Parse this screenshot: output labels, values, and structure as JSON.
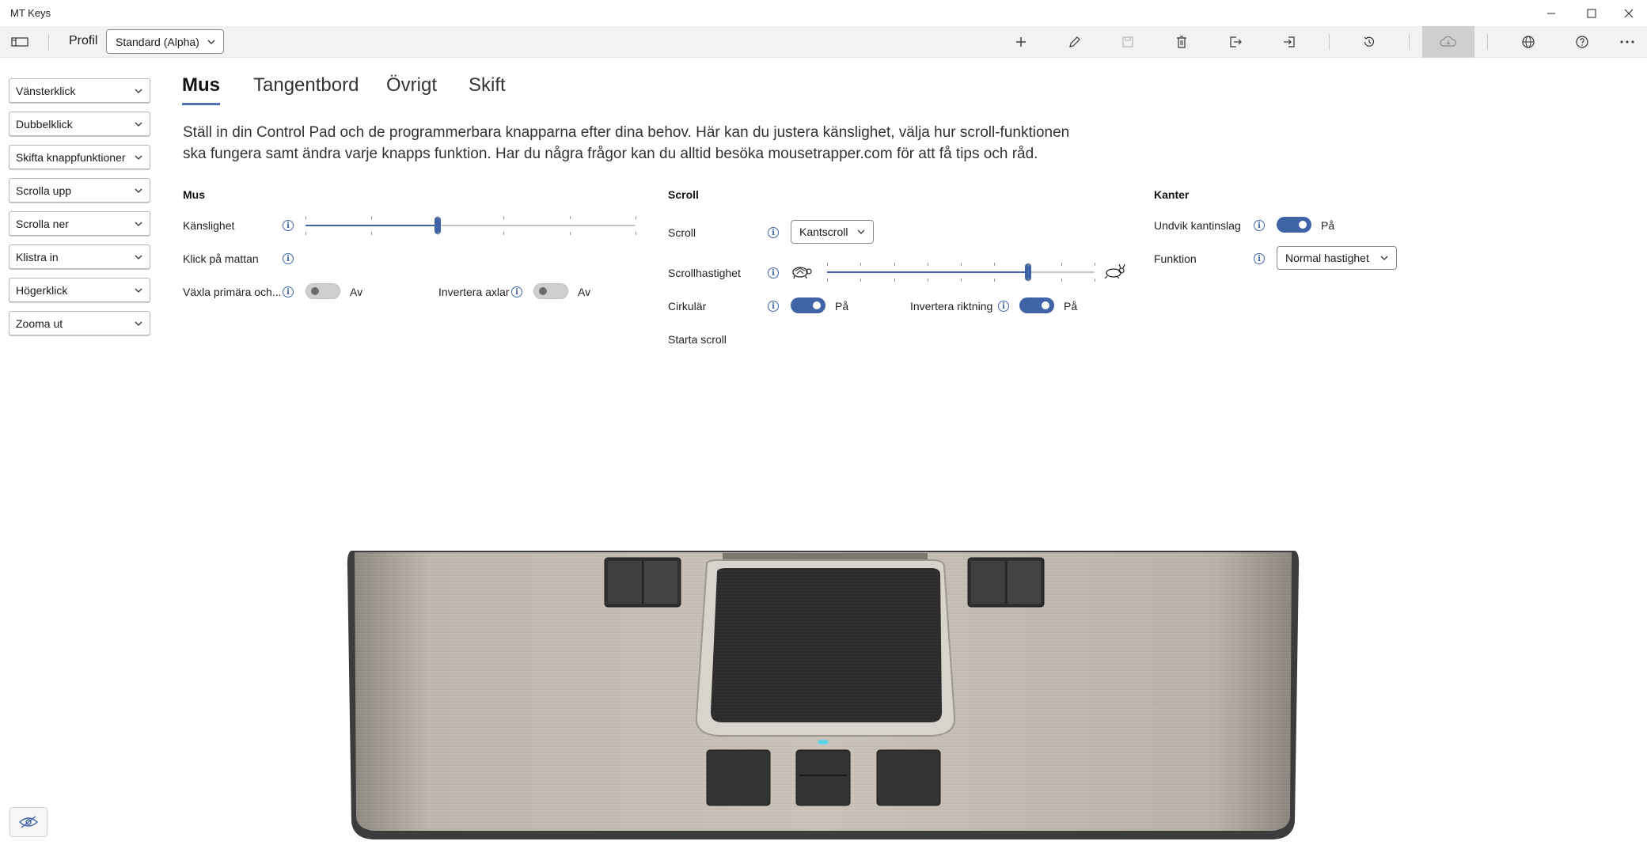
{
  "window": {
    "title": "MT Keys"
  },
  "toolbar": {
    "profile_label": "Profil",
    "profile_value": "Standard (Alpha)"
  },
  "sidebar": {
    "items": [
      {
        "label": "Vänsterklick"
      },
      {
        "label": "Dubbelklick"
      },
      {
        "label": "Skifta knappfunktioner"
      },
      {
        "label": "Scrolla upp"
      },
      {
        "label": "Scrolla ner"
      },
      {
        "label": "Klistra in"
      },
      {
        "label": "Högerklick"
      },
      {
        "label": "Zooma ut"
      }
    ]
  },
  "tabs": [
    {
      "label": "Mus",
      "active": true
    },
    {
      "label": "Tangentbord",
      "active": false
    },
    {
      "label": "Övrigt",
      "active": false
    },
    {
      "label": "Skift",
      "active": false
    }
  ],
  "description": "Ställ in din Control Pad och de programmerbara knapparna efter dina behov. Här kan du justera känslighet, välja hur scroll-funktionen ska fungera samt ändra varje knapps funktion. Har du några frågor kan du alltid besöka mousetrapper.com för att få tips och råd.",
  "mus": {
    "title": "Mus",
    "sensitivity_label": "Känslighet",
    "sensitivity_value": 0.4,
    "click_label": "Klick på mattan",
    "swap_label": "Växla primära och...",
    "swap_state": "Av",
    "invert_axes_label": "Invertera axlar",
    "invert_axes_state": "Av"
  },
  "scroll": {
    "title": "Scroll",
    "scroll_label": "Scroll",
    "scroll_value": "Kantscroll",
    "speed_label": "Scrollhastighet",
    "speed_value": 0.75,
    "circular_label": "Cirkulär",
    "circular_state": "På",
    "invert_dir_label": "Invertera riktning",
    "invert_dir_state": "På",
    "start_label": "Starta scroll"
  },
  "kanter": {
    "title": "Kanter",
    "avoid_label": "Undvik kantinslag",
    "avoid_state": "På",
    "function_label": "Funktion",
    "function_value": "Normal hastighet"
  },
  "colors": {
    "accent": "#3f63a6"
  }
}
